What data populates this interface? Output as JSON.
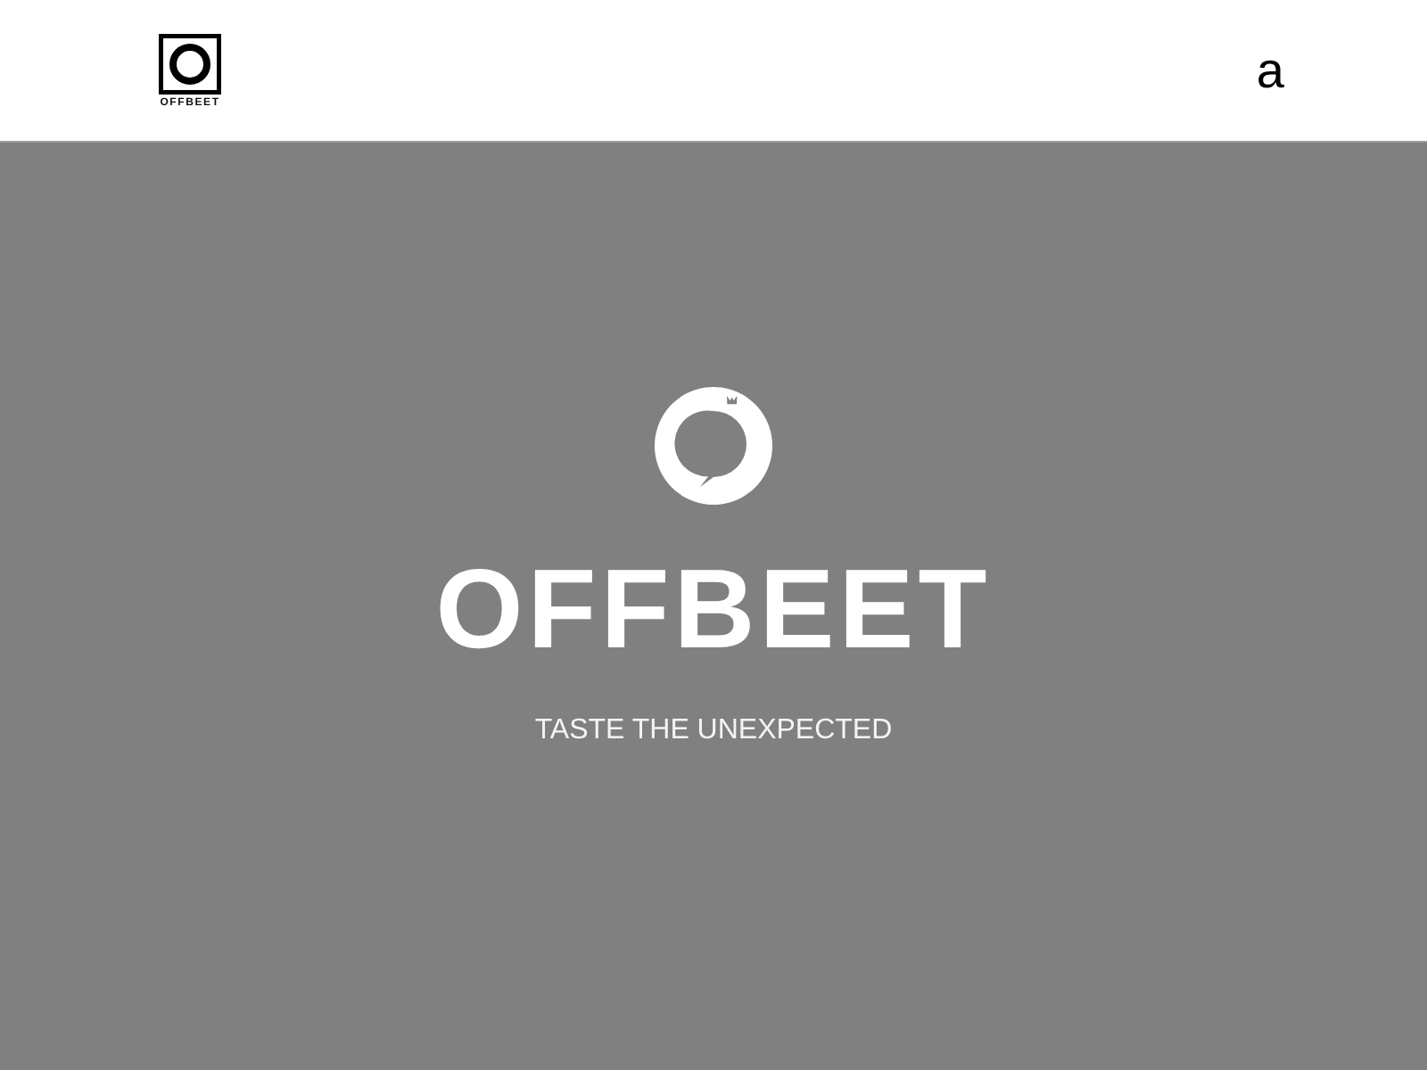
{
  "header": {
    "logo": {
      "wordmark": "OFFBEET"
    },
    "menu_glyph": "a"
  },
  "hero": {
    "title": "OFFBEET",
    "tagline": "TASTE THE UNEXPECTED"
  }
}
